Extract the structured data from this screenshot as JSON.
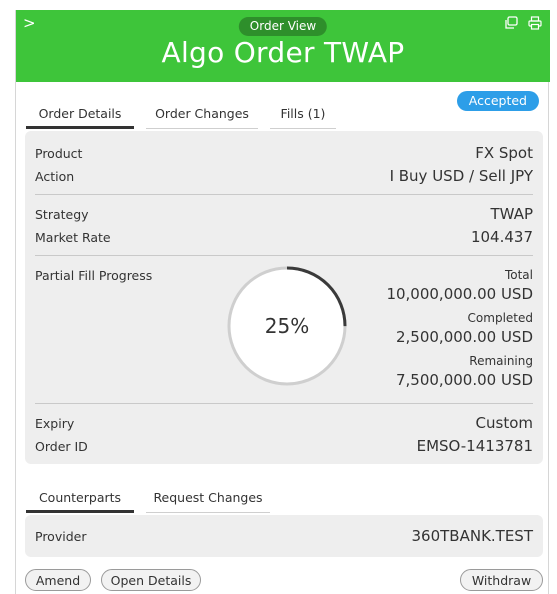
{
  "header": {
    "chevron": ">",
    "pill": "Order View",
    "title": "Algo Order TWAP",
    "icons": [
      "popout-icon",
      "print-icon"
    ],
    "color": "#3ec53a"
  },
  "status_badge": {
    "label": "Accepted",
    "color": "#2d9ee8"
  },
  "tabs": [
    {
      "label": "Order Details",
      "active": true
    },
    {
      "label": "Order Changes",
      "active": false
    },
    {
      "label": "Fills (1)",
      "active": false
    }
  ],
  "details": {
    "product": {
      "label": "Product",
      "value": "FX Spot"
    },
    "action": {
      "label": "Action",
      "value": "I Buy USD / Sell JPY"
    },
    "strategy": {
      "label": "Strategy",
      "value": "TWAP"
    },
    "market_rate": {
      "label": "Market Rate",
      "value": "104.437"
    },
    "progress": {
      "label": "Partial Fill Progress",
      "percent_text": "25%",
      "fraction": 0.25,
      "total_label": "Total",
      "total_value": "10,000,000.00 USD",
      "completed_label": "Completed",
      "completed_value": "2,500,000.00 USD",
      "remaining_label": "Remaining",
      "remaining_value": "7,500,000.00 USD"
    },
    "expiry": {
      "label": "Expiry",
      "value": "Custom"
    },
    "order_id": {
      "label": "Order ID",
      "value": "EMSO-1413781"
    }
  },
  "lower_tabs": [
    {
      "label": "Counterparts",
      "active": true
    },
    {
      "label": "Request Changes",
      "active": false
    }
  ],
  "counterparts": {
    "provider_label": "Provider",
    "provider_value": "360TBANK.TEST"
  },
  "buttons": {
    "amend": "Amend",
    "open_details": "Open Details",
    "withdraw": "Withdraw"
  }
}
